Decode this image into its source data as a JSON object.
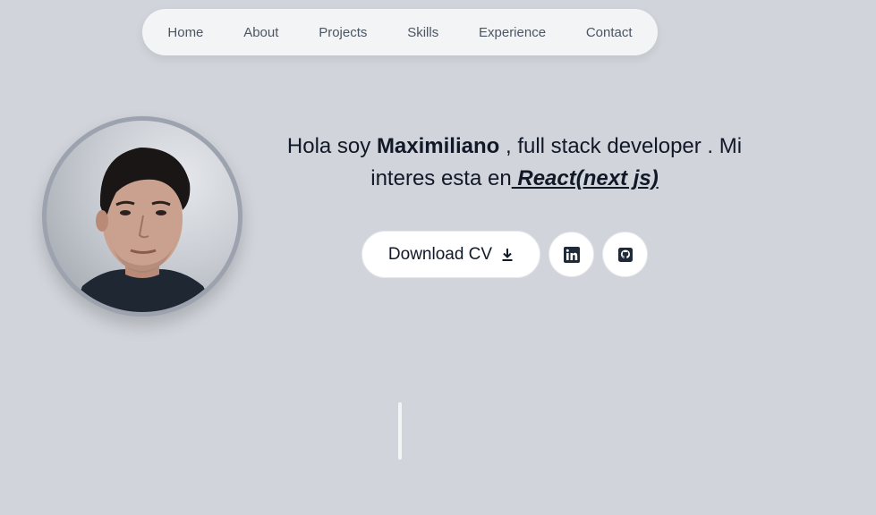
{
  "nav": {
    "items": [
      {
        "label": "Home"
      },
      {
        "label": "About"
      },
      {
        "label": "Projects"
      },
      {
        "label": "Skills"
      },
      {
        "label": "Experience"
      },
      {
        "label": "Contact"
      }
    ]
  },
  "hero": {
    "greeting": "Hola soy ",
    "name": "Maximiliano",
    "role_text": " , full stack developer . Mi interes esta en",
    "tech": " React(next js)",
    "cv_button": "Download CV",
    "cv_icon": "download-icon",
    "linkedin_icon": "linkedin-icon",
    "github_icon": "github-icon"
  },
  "colors": {
    "background": "#d1d5db",
    "nav_background": "#f3f4f6",
    "text": "#111827"
  }
}
